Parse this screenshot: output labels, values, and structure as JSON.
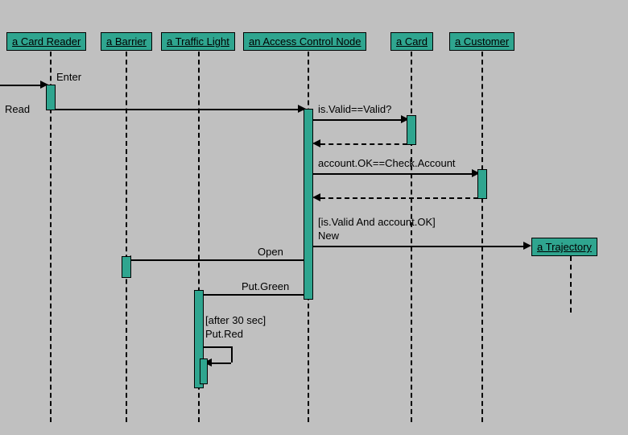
{
  "participants": {
    "cardReader": "a Card Reader",
    "barrier": "a Barrier",
    "trafficLight": "a Traffic Light",
    "accessControlNode": "an Access Control Node",
    "card": "a Card",
    "customer": "a Customer",
    "trajectory": "a Trajectory"
  },
  "messages": {
    "enter": "Enter",
    "read": "Read",
    "isValid": "is.Valid==Valid?",
    "accountOK": "account.OK==Check.Account",
    "guard": "[is.Valid And account.OK]",
    "new": "New",
    "open": "Open",
    "putGreen": "Put.Green",
    "putRedGuard": "[after 30 sec]",
    "putRed": "Put.Red"
  },
  "chart_data": {
    "type": "sequence-diagram",
    "participants": [
      "a Card Reader",
      "a Barrier",
      "a Traffic Light",
      "an Access Control Node",
      "a Card",
      "a Customer",
      "a Trajectory"
    ],
    "interactions": [
      {
        "from": "external",
        "to": "a Card Reader",
        "label": "Enter",
        "type": "sync"
      },
      {
        "from": "a Card Reader",
        "to": "an Access Control Node",
        "label": "Read",
        "type": "sync"
      },
      {
        "from": "an Access Control Node",
        "to": "a Card",
        "label": "is.Valid==Valid?",
        "type": "sync"
      },
      {
        "from": "a Card",
        "to": "an Access Control Node",
        "label": "",
        "type": "return"
      },
      {
        "from": "an Access Control Node",
        "to": "a Customer",
        "label": "account.OK==Check.Account",
        "type": "sync"
      },
      {
        "from": "a Customer",
        "to": "an Access Control Node",
        "label": "",
        "type": "return"
      },
      {
        "from": "an Access Control Node",
        "to": "a Trajectory",
        "label": "[is.Valid And account.OK] New",
        "type": "create"
      },
      {
        "from": "an Access Control Node",
        "to": "a Barrier",
        "label": "Open",
        "type": "sync"
      },
      {
        "from": "an Access Control Node",
        "to": "a Traffic Light",
        "label": "Put.Green",
        "type": "sync"
      },
      {
        "from": "a Traffic Light",
        "to": "a Traffic Light",
        "label": "[after 30 sec] Put.Red",
        "type": "self"
      }
    ]
  }
}
